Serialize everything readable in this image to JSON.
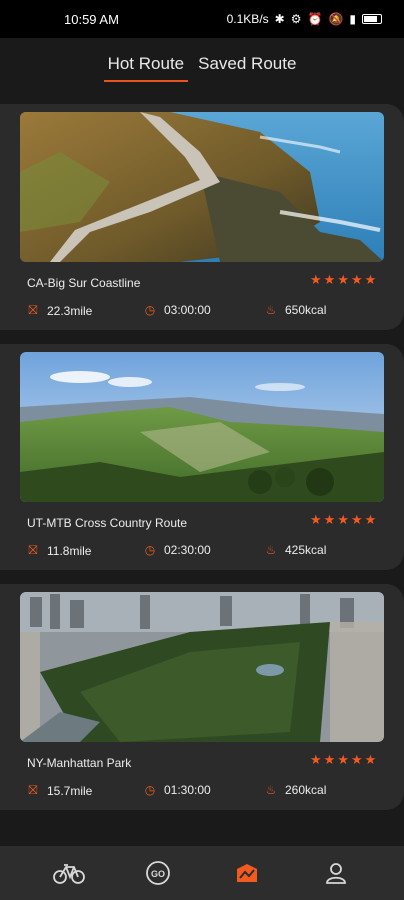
{
  "status_bar": {
    "time": "10:59 AM",
    "network_speed": "0.1KB/s",
    "icons": [
      "bluetooth-icon",
      "settings-icon",
      "alarm-icon",
      "mute-icon",
      "signal-icon",
      "battery-icon"
    ]
  },
  "tabs": [
    {
      "label": "Hot Route",
      "active": true
    },
    {
      "label": "Saved Route",
      "active": false
    }
  ],
  "routes": [
    {
      "title": "CA-Big Sur Coastline",
      "distance": "22.3mile",
      "duration": "03:00:00",
      "calories": "650kcal",
      "rating": 5,
      "image": "coastline-road"
    },
    {
      "title": "UT-MTB Cross Country Route",
      "distance": "11.8mile",
      "duration": "02:30:00",
      "calories": "425kcal",
      "rating": 5,
      "image": "green-hills"
    },
    {
      "title": "NY-Manhattan Park",
      "distance": "15.7mile",
      "duration": "01:30:00",
      "calories": "260kcal",
      "rating": 5,
      "image": "city-park-aerial"
    }
  ],
  "bottom_nav": [
    {
      "name": "bike-icon",
      "active": false
    },
    {
      "name": "go-icon",
      "label": "GO",
      "active": false
    },
    {
      "name": "route-icon",
      "active": true
    },
    {
      "name": "profile-icon",
      "active": false
    }
  ],
  "colors": {
    "accent": "#f25a1f",
    "background": "#1a1a1a",
    "card": "#2b2b2b",
    "nav": "#2d2d2d"
  }
}
